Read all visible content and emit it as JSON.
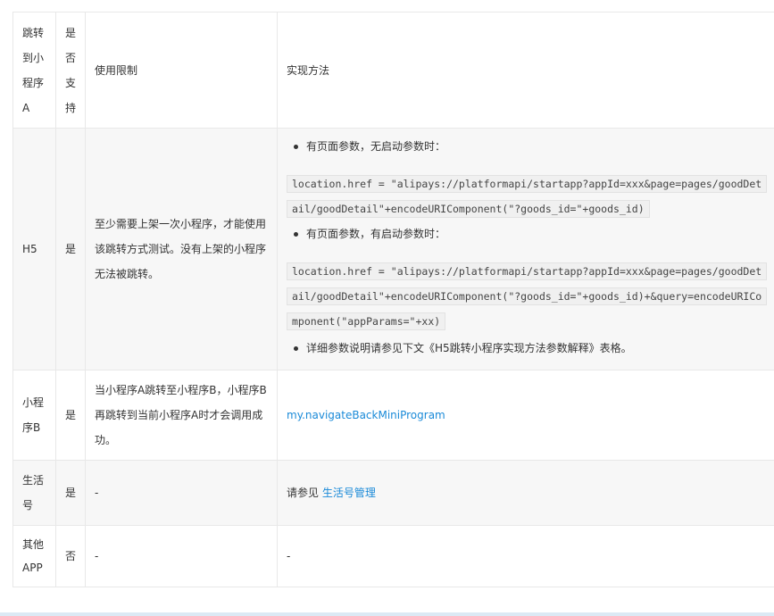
{
  "table": {
    "headers": {
      "col1": "跳转到小程序A",
      "col2": "是否支持",
      "col3": "使用限制",
      "col4": "实现方法"
    },
    "rows": [
      {
        "target": "H5",
        "supported": "是",
        "limit": "至少需要上架一次小程序，才能使用该跳转方式测试。没有上架的小程序无法被跳转。",
        "method": {
          "bullet1": "有页面参数，无启动参数时：",
          "code1": "location.href = \"alipays://platformapi/startapp?appId=xxx&page=pages/goodDetail/goodDetail\"+encodeURIComponent(\"?goods_id=\"+goods_id)",
          "bullet2": "有页面参数，有启动参数时：",
          "code2": "location.href = \"alipays://platformapi/startapp?appId=xxx&page=pages/goodDetail/goodDetail\"+encodeURIComponent(\"?goods_id=\"+goods_id)+&query=encodeURIComponent(\"appParams=\"+xx)",
          "bullet3": "详细参数说明请参见下文《H5跳转小程序实现方法参数解释》表格。"
        }
      },
      {
        "target": "小程序B",
        "supported": "是",
        "limit": "当小程序A跳转至小程序B，小程序B再跳转到当前小程序A时才会调用成功。",
        "method_link": "my.navigateBackMiniProgram"
      },
      {
        "target": "生活号",
        "supported": "是",
        "limit": "-",
        "method_prefix": "请参见",
        "method_link": "生活号管理"
      },
      {
        "target": "其他APP",
        "supported": "否",
        "limit": "-",
        "method": "-"
      }
    ]
  },
  "colors": {
    "link": "#1a8ad8",
    "border": "#e8e8e8",
    "shade": "#f7f7f7",
    "text": "#333333"
  }
}
